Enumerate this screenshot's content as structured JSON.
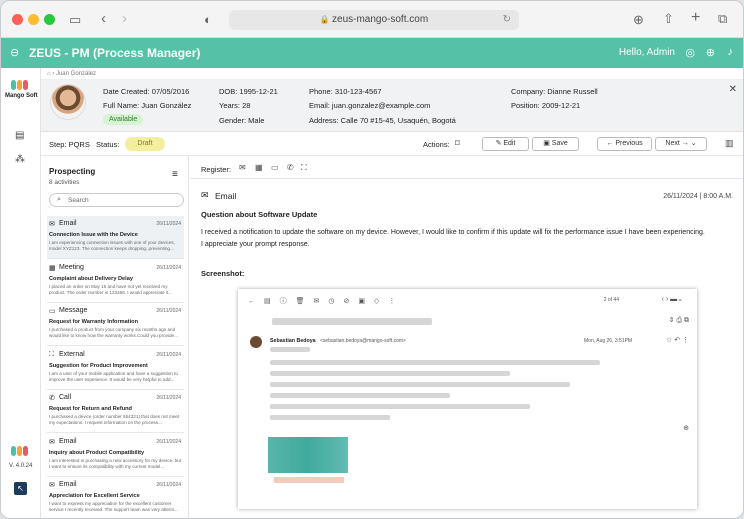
{
  "browser": {
    "url": "zeus-mango-soft.com"
  },
  "app": {
    "title": "ZEUS - PM (Process Manager)",
    "greeting": "Hello, Admin",
    "brand": "Mango Soft",
    "version": "V. 4.0.24"
  },
  "breadcrumb": {
    "current": "Juan González"
  },
  "profile": {
    "date_created": "Date Created: 07/05/2016",
    "full_name": "Full Name: Juan González",
    "status": "Available",
    "dob": "DOB: 1995-12-21",
    "years": "Years: 28",
    "gender": "Gender: Male",
    "phone": "Phone: 310-123-4567",
    "email": "Email: juan.gonzalez@example.com",
    "address": "Address: Calle 70 #15-45, Usaquén, Bogotá",
    "company": "Company: Dianne Russell",
    "position": "Position: 2009-12-21"
  },
  "stepbar": {
    "step": "Step: PQRS",
    "status_label": "Status:",
    "status_value": "Draft",
    "actions": "Actions:",
    "edit": "Edit",
    "save": "Save",
    "previous": "Previous",
    "next": "Next"
  },
  "activities": {
    "title": "Prospecting",
    "count": "8 activities",
    "search_placeholder": "Search",
    "items": [
      {
        "type": "Email",
        "date": "26/11/2024",
        "title": "Connection Issue with the Device",
        "body": "I am experiencing connection issues with one of your devices, model XYZ123. The connection keeps dropping, preventing..."
      },
      {
        "type": "Meeting",
        "date": "26/11/2024",
        "title": "Complaint about Delivery Delay",
        "body": "I placed an order on May 15 and have not yet received my product. The order number is 123456. I would appreciate it..."
      },
      {
        "type": "Message",
        "date": "26/11/2024",
        "title": "Request for Warranty Information",
        "body": "I purchased a product from your company six months ago and would like to know how the warranty works.Could you provide..."
      },
      {
        "type": "External",
        "date": "26/11/2024",
        "title": "Suggestion for Product Improvement",
        "body": "I am a user of your mobile application and have a suggestion to improve the user experience. It would be very helpful to add..."
      },
      {
        "type": "Call",
        "date": "26/11/2024",
        "title": "Request for Return and Refund",
        "body": "I purchased a device (order number 654321) that does not meet my expectations. I request information on the process..."
      },
      {
        "type": "Email",
        "date": "26/11/2024",
        "title": "Inquiry about Product Compatibility",
        "body": "I am interested in purchasing a new accessory for my device, but I want to ensure its compatibility with my current model..."
      },
      {
        "type": "Email",
        "date": "26/11/2024",
        "title": "Appreciation for Excellent Service",
        "body": "I want to express my appreciation for the excellent customer service I recently received. The support team was very attenti..."
      }
    ]
  },
  "detail": {
    "register": "Register:",
    "type": "Email",
    "datetime": "26/11/2024 | 8:00 A.M.",
    "subject": "Question about Software Update",
    "body1": "I received a notification to update the software on my device. However, I would like to confirm if this update will fix the performance issue I have been experiencing.",
    "body2": "I appreciate your prompt response.",
    "screenshot_label": "Screenshot:",
    "shot": {
      "sender": "Sebastian Bedoya",
      "sender_email": "<sebastian.bedoya@mango-soft.com>",
      "date": "Mon, Aug 26, 3:51PM",
      "pager": "2 of 44"
    }
  },
  "colors": {
    "accent": "#55c1a5",
    "draft": "#f3ef9e"
  }
}
